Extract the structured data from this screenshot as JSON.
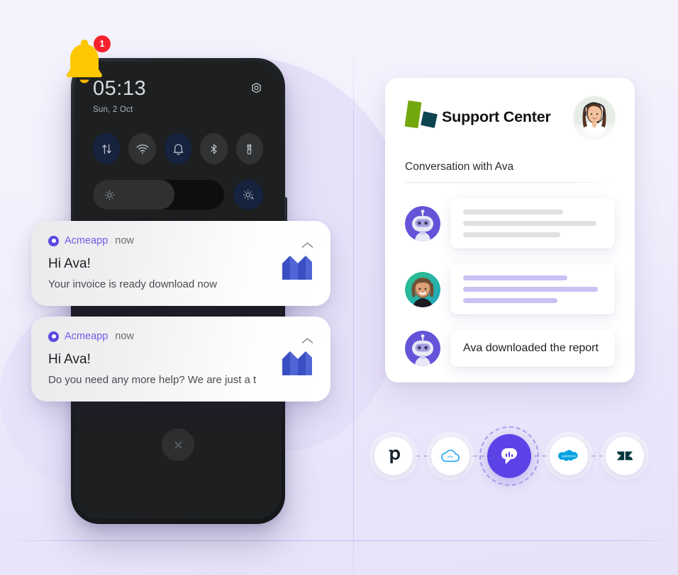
{
  "theme": {
    "bg_start": "#f4f3fd",
    "bg_end": "#e6e2f8",
    "accent_purple": "#5b43e8",
    "notif_app_purple": "#6e5de6",
    "badge_red": "#f5222d",
    "bell_yellow": "#fdc800",
    "brand_green": "#73a70e",
    "brand_teal": "#0d4450",
    "skeleton_gray": "#e0e0e0",
    "skeleton_purple": "#c9c2f5"
  },
  "phone": {
    "quick_settings": {
      "time": "05:13",
      "date": "Sun, 2 Oct",
      "settings_icon": "gear-icon",
      "toggles": [
        {
          "name": "mobile-data-toggle",
          "icon": "data-arrows-icon",
          "state": "on"
        },
        {
          "name": "wifi-toggle",
          "icon": "wifi-icon",
          "state": "off"
        },
        {
          "name": "notifications-toggle",
          "icon": "bell-icon",
          "state": "on"
        },
        {
          "name": "bluetooth-toggle",
          "icon": "bluetooth-icon",
          "state": "off"
        },
        {
          "name": "flashlight-toggle",
          "icon": "flashlight-icon",
          "state": "off"
        }
      ],
      "brightness": {
        "icon": "brightness-sun-icon",
        "level_percent": 62,
        "auto_icon": "auto-brightness-icon"
      }
    },
    "clear_all_icon": "close-x-icon"
  },
  "bell": {
    "icon": "notification-bell-icon",
    "badge_count": "1"
  },
  "notifications": [
    {
      "app_icon": "acmeapp-icon",
      "app_name": "Acmeapp",
      "timestamp": "now",
      "collapse_icon": "chevron-up-icon",
      "title": "Hi Ava!",
      "body": "Your invoice is ready download now",
      "logo": "m-logo"
    },
    {
      "app_icon": "acmeapp-icon",
      "app_name": "Acmeapp",
      "timestamp": "now",
      "collapse_icon": "chevron-up-icon",
      "title": "Hi Ava!",
      "body": "Do you need any more help? We are just a t",
      "logo": "m-logo"
    }
  ],
  "support_card": {
    "logo": "support-center-logo",
    "title": "Support Center",
    "agent_avatar": "support-agent-avatar",
    "conversation_label": "Conversation with Ava",
    "messages": [
      {
        "sender": "bot",
        "avatar": "robot-avatar",
        "type": "skeleton",
        "skeleton_color": "#e0e0e0",
        "line_widths": [
          "72%",
          "96%",
          "70%"
        ]
      },
      {
        "sender": "user",
        "avatar": "user-avatar",
        "type": "skeleton",
        "skeleton_color": "#c9c2f5",
        "line_widths": [
          "75%",
          "97%",
          "68%"
        ]
      },
      {
        "sender": "bot",
        "avatar": "robot-avatar",
        "type": "text",
        "text": "Ava downloaded the report"
      }
    ]
  },
  "integrations": [
    {
      "name": "pipedrive",
      "icon": "pipedrive-icon",
      "highlighted": false
    },
    {
      "name": "cloud",
      "icon": "cloud-icon",
      "highlighted": false
    },
    {
      "name": "chat-hub",
      "icon": "chat-bubble-icon",
      "highlighted": true
    },
    {
      "name": "salesforce",
      "icon": "salesforce-icon",
      "highlighted": false
    },
    {
      "name": "zendesk",
      "icon": "zendesk-icon",
      "highlighted": false
    }
  ]
}
